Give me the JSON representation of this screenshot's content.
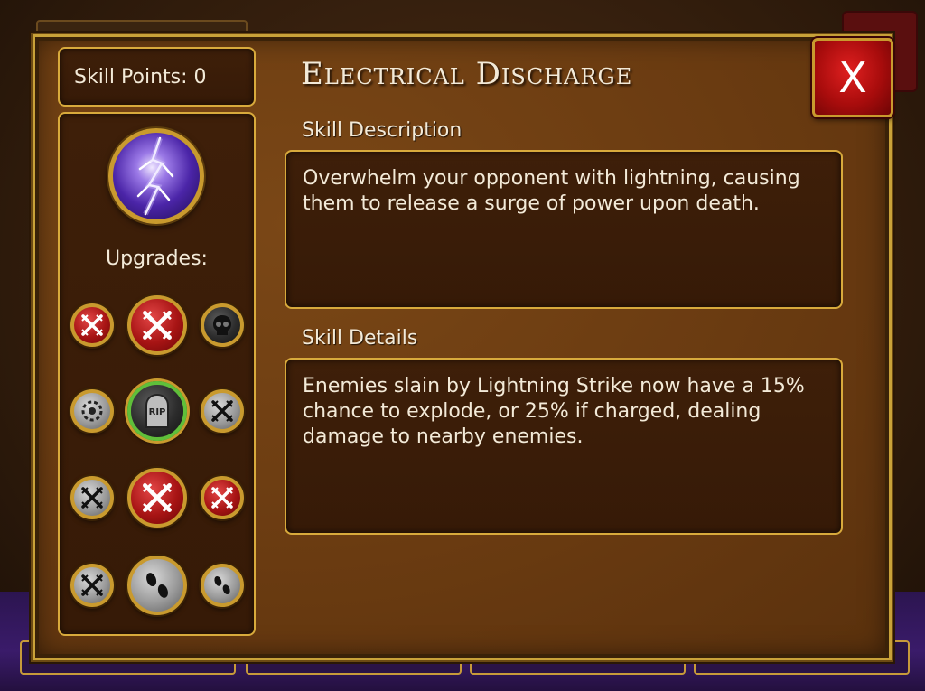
{
  "skill_points": {
    "label": "Skill Points: 0"
  },
  "skill": {
    "title": "Electrical Discharge",
    "icon": "lightning-orb-icon"
  },
  "upgrades": {
    "label": "Upgrades:",
    "nodes": [
      {
        "icon": "crossed-swords-icon",
        "style": "red"
      },
      {
        "icon": "crossed-swords-icon",
        "style": "red"
      },
      {
        "icon": "skull-icon",
        "style": "dark"
      },
      {
        "icon": "target-icon",
        "style": "grey"
      },
      {
        "icon": "tombstone-icon",
        "style": "dark",
        "text": "RIP"
      },
      {
        "icon": "crossed-swords-icon",
        "style": "grey"
      },
      {
        "icon": "crossed-swords-icon",
        "style": "grey"
      },
      {
        "icon": "crossed-swords-icon",
        "style": "red"
      },
      {
        "icon": "crossed-swords-icon",
        "style": "red"
      },
      {
        "icon": "crossed-swords-icon",
        "style": "grey"
      },
      {
        "icon": "footprints-icon",
        "style": "grey"
      },
      {
        "icon": "footprints-icon",
        "style": "grey"
      }
    ]
  },
  "description": {
    "label": "Skill Description",
    "text": "Overwhelm your opponent with lightning, causing them to release a surge of power upon death."
  },
  "details": {
    "label": "Skill Details",
    "text": "Enemies slain by Lightning Strike now have a 15% chance to explode, or 25% if charged, dealing damage to nearby enemies."
  },
  "close_button": {
    "label": "X",
    "icon": "close-icon"
  },
  "colors": {
    "panel_border": "#c9a239",
    "box_bg": "#3e1f09",
    "text": "#f3ead8",
    "close_red": "#a80c0c",
    "orb_purple": "#4b25a8"
  }
}
